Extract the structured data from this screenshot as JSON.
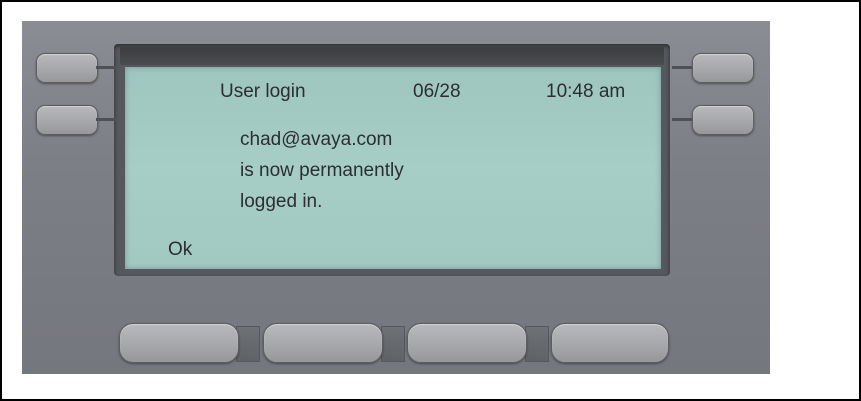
{
  "display": {
    "header": {
      "title": "User login",
      "date": "06/28",
      "time": "10:48 am"
    },
    "message_lines": [
      "chad@avaya.com",
      "is now permanently",
      "logged in."
    ],
    "softkey_labels": [
      "Ok"
    ]
  },
  "colors": {
    "lcd_background": "#a3c9c3",
    "lcd_text": "#2b2f2f",
    "phone_body": "#7c7f85",
    "button": "#a4a6aa"
  }
}
